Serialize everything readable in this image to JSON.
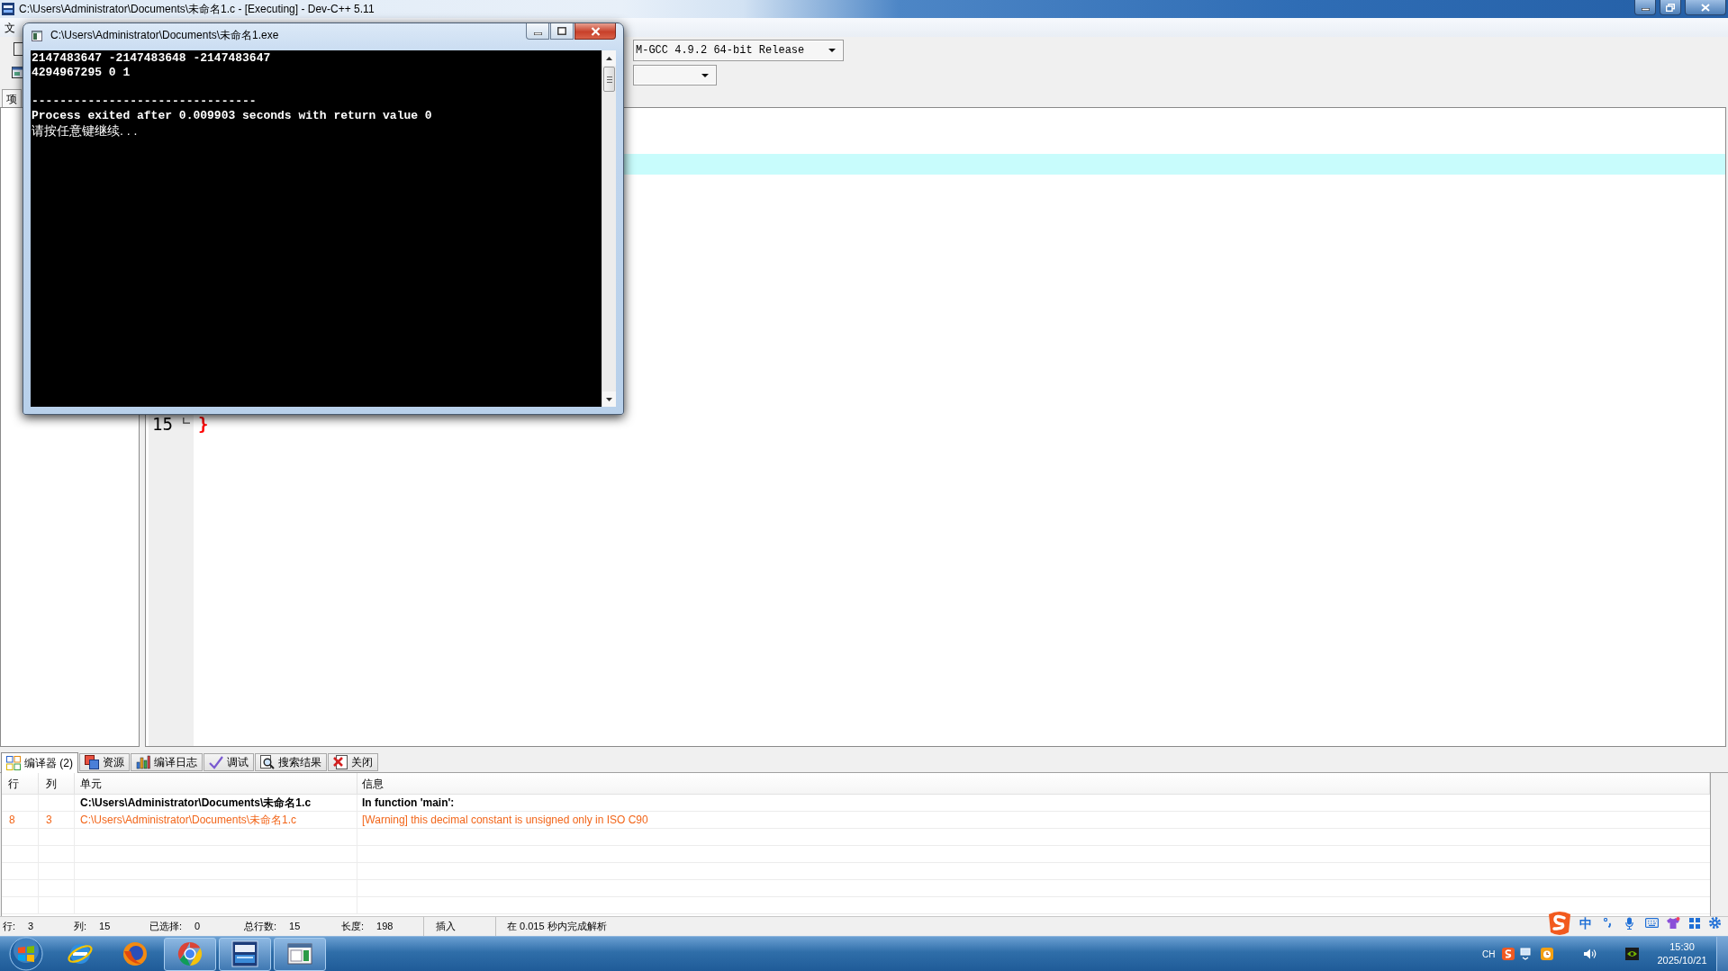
{
  "window": {
    "title": "C:\\Users\\Administrator\\Documents\\未命名1.c - [Executing] - Dev-C++ 5.11"
  },
  "menu_bar": {
    "items": [
      "文"
    ]
  },
  "toolbar": {
    "compiler": "M-GCC 4.9.2 64-bit Release"
  },
  "project_panel": {
    "tabs": [
      "项"
    ]
  },
  "editor": {
    "lines": [
      {
        "number": "15",
        "code": "}"
      }
    ]
  },
  "console_window": {
    "title": "C:\\Users\\Administrator\\Documents\\未命名1.exe",
    "output": [
      "2147483647 -2147483648 -2147483647",
      "4294967295 0 1"
    ],
    "separator": "--------------------------------",
    "exit_message": "Process exited after 0.009903 seconds with return value 0",
    "prompt": "请按任意键继续. . ."
  },
  "bottom_panel": {
    "tabs": [
      {
        "label": "编译器 (2)",
        "selected": true
      },
      {
        "label": "资源",
        "selected": false
      },
      {
        "label": "编译日志",
        "selected": false
      },
      {
        "label": "调试",
        "selected": false
      },
      {
        "label": "搜索结果",
        "selected": false
      },
      {
        "label": "关闭",
        "selected": false
      }
    ],
    "table": {
      "columns": [
        "行",
        "列",
        "单元",
        "信息"
      ],
      "rows": [
        {
          "kind": "context",
          "unit": "C:\\Users\\Administrator\\Documents\\未命名1.c",
          "message": "In function 'main':"
        },
        {
          "kind": "warning",
          "line": "8",
          "column": "3",
          "unit": "C:\\Users\\Administrator\\Documents\\未命名1.c",
          "message": "[Warning] this decimal constant is unsigned only in ISO C90"
        }
      ]
    }
  },
  "status_bar": {
    "fields": [
      {
        "label": "行:",
        "value": "3"
      },
      {
        "label": "列:",
        "value": "15"
      },
      {
        "label": "已选择:",
        "value": "0"
      },
      {
        "label": "总行数:",
        "value": "15"
      },
      {
        "label": "长度:",
        "value": "198"
      },
      {
        "label": "插入"
      },
      {
        "label": "在 0.015 秒内完成解析"
      }
    ]
  },
  "ime_bar": {
    "mode": "中"
  },
  "taskbar": {
    "apps": [
      {
        "running": false
      },
      {
        "running": false
      },
      {
        "running": true
      },
      {
        "running": true
      },
      {
        "running": true
      }
    ],
    "tray": {
      "language": "CH",
      "time": "15:30",
      "date": "2025/10/21"
    }
  }
}
